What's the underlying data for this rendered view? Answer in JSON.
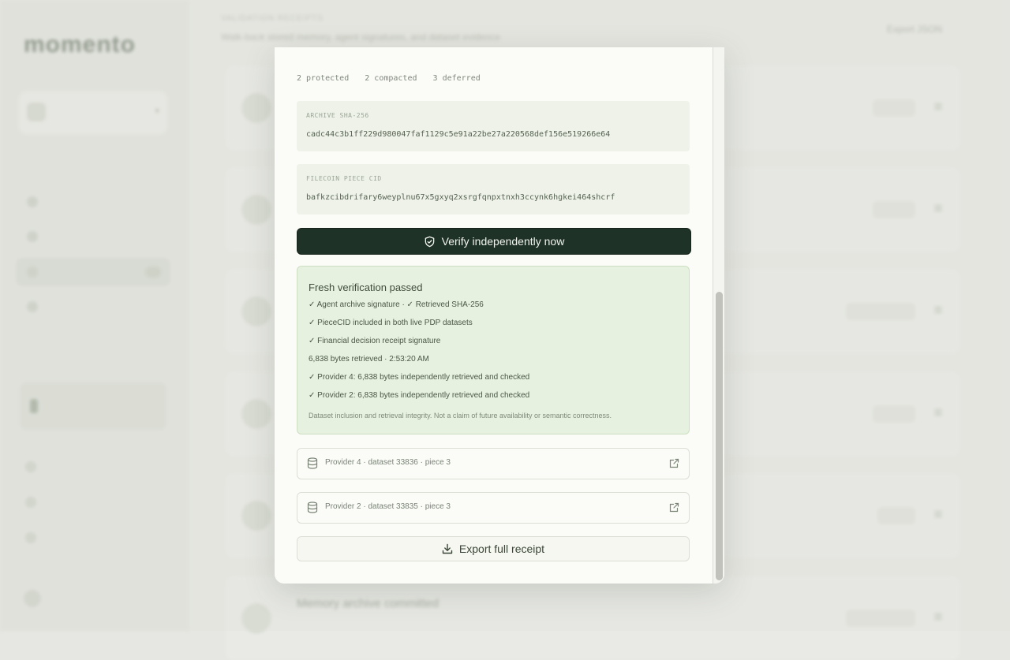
{
  "modal": {
    "counts": {
      "protected": "2 protected",
      "compacted": "2 compacted",
      "deferred": "3 deferred"
    },
    "archive_label": "ARCHIVE SHA-256",
    "archive_value": "cadc44c3b1ff229d980047faf1129c5e91a22be27a220568def156e519266e64",
    "cid_label": "FILECOIN PIECE CID",
    "cid_value": "bafkzcibdrifary6weyplnu67x5gxyq2xsrgfqnpxtnxh3ccynk6hgkei464shcrf",
    "verify_button": "Verify independently now",
    "result": {
      "title": "Fresh verification passed",
      "lines": [
        "✓ Agent archive signature · ✓ Retrieved SHA-256",
        "✓ PieceCID included in both live PDP datasets",
        "✓ Financial decision receipt signature",
        "6,838 bytes retrieved · 2:53:20 AM",
        "✓ Provider 4: 6,838 bytes independently retrieved and checked",
        "✓ Provider 2: 6,838 bytes independently retrieved and checked"
      ],
      "note": "Dataset inclusion and retrieval integrity. Not a claim of future availability or semantic correctness."
    },
    "providers": [
      {
        "label": "Provider 4 · dataset 33836 · piece 3",
        "icon": "database-icon"
      },
      {
        "label": "Provider 2 · dataset 33835 · piece 3",
        "icon": "database-icon"
      }
    ],
    "export_button": "Export full receipt"
  },
  "background": {
    "logo": "momento",
    "main_title": "VALIDATION RECEIPTS",
    "main_subtitle": "Walk-back stored memory, agent signatures, and dataset evidence",
    "export_top": "Export JSON",
    "last_row_title": "Memory archive committed"
  },
  "colors": {
    "accent": "#1f3227",
    "success_bg": "#e7f1df",
    "hash_bg": "#eef2e8"
  }
}
